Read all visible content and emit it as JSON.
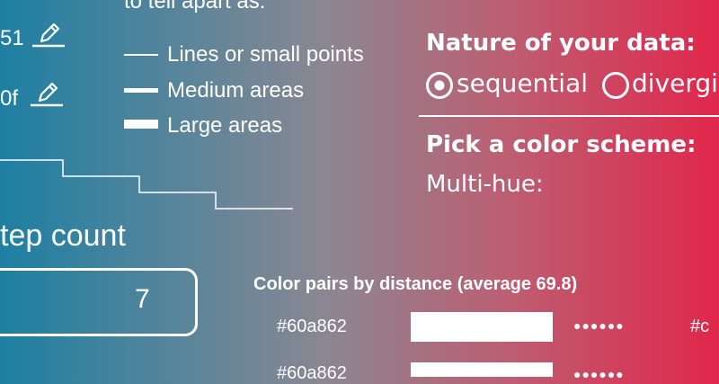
{
  "left_panel": {
    "colors": [
      {
        "partial_text": "51"
      },
      {
        "partial_text": "0f"
      }
    ],
    "tell_apart_label": "to tell apart as:",
    "line_types": [
      {
        "label": "Lines or small points"
      },
      {
        "label": "Medium areas"
      },
      {
        "label": "Large areas"
      }
    ],
    "step_count": {
      "label": "tep count",
      "value": "7"
    }
  },
  "right_panel": {
    "nature_heading": "Nature of your data:",
    "options": [
      {
        "label": "sequential",
        "selected": true
      },
      {
        "label": "divergin",
        "selected": false
      }
    ],
    "scheme_heading": "Pick a color scheme:",
    "scheme_sub": "Multi-hue:"
  },
  "pairs": {
    "heading": "Color pairs by distance (average 69.8)",
    "rows": [
      {
        "from": "#60a862",
        "dots": "●●●●●●",
        "to": "#c"
      },
      {
        "from": "#60a862",
        "dots": "●●●●●●",
        "to": ""
      }
    ]
  },
  "colors": {
    "gradient_start": "#1e7fa2",
    "gradient_end": "#e1274b"
  }
}
